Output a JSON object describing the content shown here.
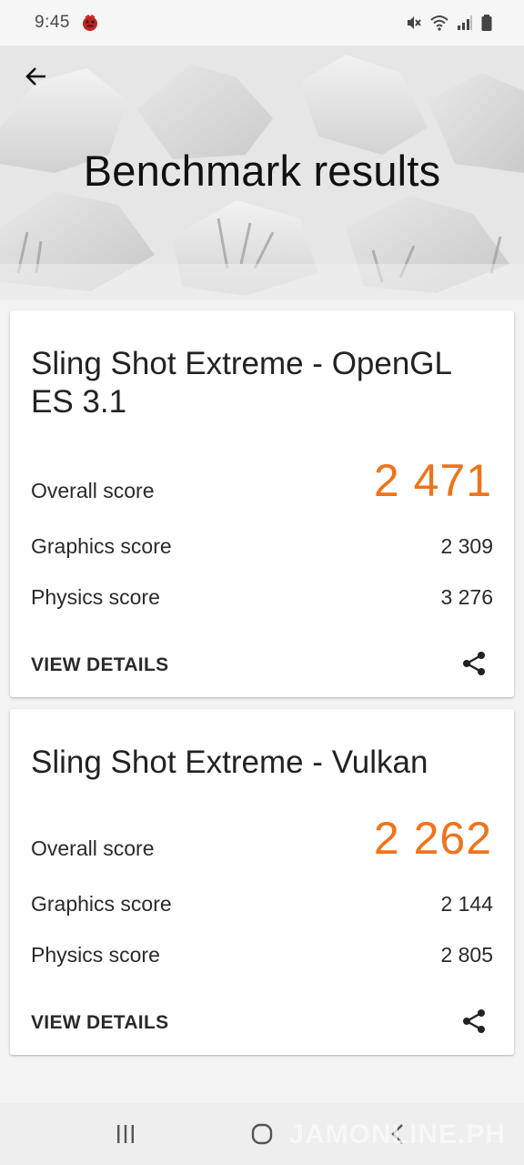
{
  "status_bar": {
    "time": "9:45",
    "icons": [
      "app-notification-icon",
      "mute-icon",
      "wifi-icon",
      "signal-icon",
      "battery-icon"
    ]
  },
  "header": {
    "title": "Benchmark results",
    "back_icon": "arrow-left-icon"
  },
  "results": [
    {
      "title": "Sling Shot Extreme - OpenGL ES 3.1",
      "overall_label": "Overall score",
      "overall_value": "2 471",
      "graphics_label": "Graphics score",
      "graphics_value": "2 309",
      "physics_label": "Physics score",
      "physics_value": "3 276",
      "view_details": "VIEW DETAILS",
      "share_icon": "share-icon"
    },
    {
      "title": "Sling Shot Extreme - Vulkan",
      "overall_label": "Overall score",
      "overall_value": "2 262",
      "graphics_label": "Graphics score",
      "graphics_value": "2 144",
      "physics_label": "Physics score",
      "physics_value": "2 805",
      "view_details": "VIEW DETAILS",
      "share_icon": "share-icon"
    }
  ],
  "nav_bar": {
    "icons": [
      "recents-icon",
      "home-icon",
      "back-icon"
    ],
    "watermark": "JAMONLINE.PH"
  },
  "colors": {
    "accent": "#f0731b",
    "background": "#f3f3f3",
    "card": "#ffffff"
  }
}
